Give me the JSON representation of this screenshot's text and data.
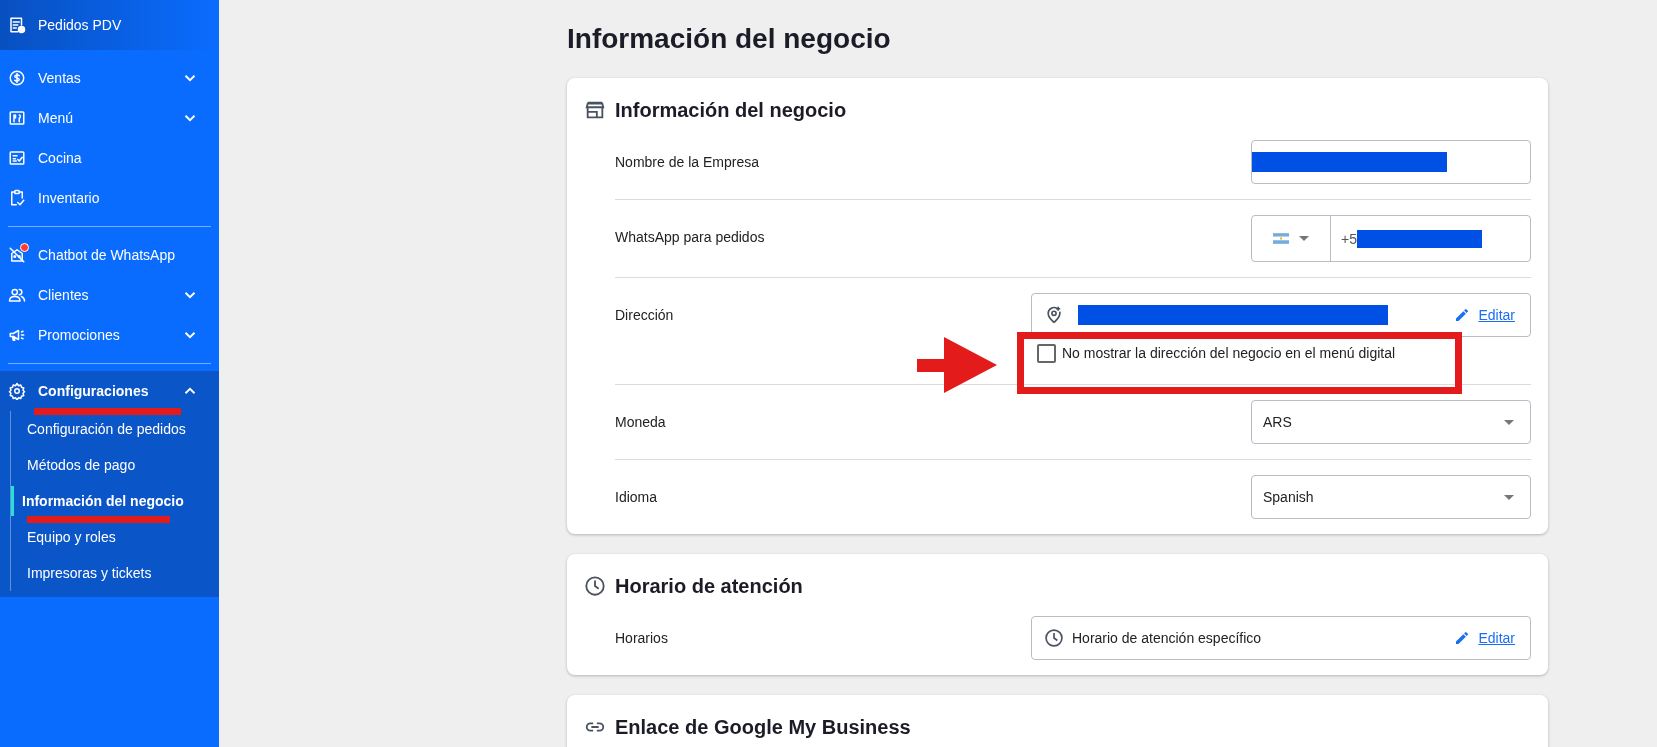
{
  "sidebar": {
    "header": {
      "label": "Pedidos PDV"
    },
    "sections": [
      {
        "items": [
          {
            "label": "Ventas",
            "expandable": true,
            "expanded": false,
            "notification": false
          },
          {
            "label": "Menú",
            "expandable": true,
            "expanded": false,
            "notification": false
          },
          {
            "label": "Cocina",
            "expandable": false,
            "expanded": false,
            "notification": false
          },
          {
            "label": "Inventario",
            "expandable": false,
            "expanded": false,
            "notification": false
          }
        ]
      },
      {
        "items": [
          {
            "label": "Chatbot de WhatsApp",
            "expandable": false,
            "expanded": false,
            "notification": true
          },
          {
            "label": "Clientes",
            "expandable": true,
            "expanded": false,
            "notification": false
          },
          {
            "label": "Promociones",
            "expandable": true,
            "expanded": false,
            "notification": false
          }
        ]
      },
      {
        "items": [
          {
            "label": "Configuraciones",
            "expandable": true,
            "expanded": true,
            "notification": false,
            "children": [
              {
                "label": "Configuración de pedidos",
                "selected": false
              },
              {
                "label": "Métodos de pago",
                "selected": false
              },
              {
                "label": "Información del negocio",
                "selected": true
              },
              {
                "label": "Equipo y roles",
                "selected": false
              },
              {
                "label": "Impresoras y tickets",
                "selected": false
              }
            ]
          }
        ]
      }
    ]
  },
  "page": {
    "title": "Información del negocio"
  },
  "cards": [
    {
      "title": "Información del negocio",
      "rows": [
        {
          "kind": "text",
          "label": "Nombre de la Empresa"
        },
        {
          "kind": "phone",
          "label": "WhatsApp para pedidos",
          "value": "+5"
        },
        {
          "kind": "address",
          "label": "Dirección",
          "link": "Editar",
          "checkbox": {
            "label": "No mostrar la dirección del negocio en el menú digital",
            "checked": false
          }
        },
        {
          "kind": "select",
          "label": "Moneda",
          "value": "ARS"
        },
        {
          "kind": "select",
          "label": "Idioma",
          "value": "Spanish"
        }
      ]
    },
    {
      "title": "Horario de atención",
      "rows": [
        {
          "kind": "schedule",
          "label": "Horarios",
          "value": "Horario de atención específico",
          "link": "Editar"
        }
      ]
    },
    {
      "title": "Enlace de Google My Business"
    }
  ]
}
